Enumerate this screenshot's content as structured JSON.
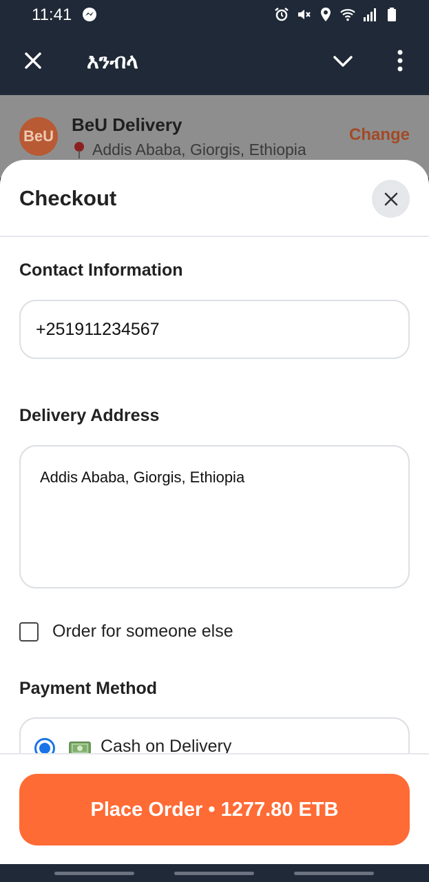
{
  "status_bar": {
    "time": "11:41",
    "icons": [
      "messenger-icon",
      "alarm-icon",
      "mute-icon",
      "location-icon",
      "wifi-icon",
      "signal-icon",
      "battery-icon"
    ]
  },
  "app_bar": {
    "title": "እንብላ",
    "icons": [
      "close-icon",
      "chevron-down-icon",
      "more-vertical-icon"
    ]
  },
  "shop": {
    "avatar_text": "BeU",
    "name": "BeU Delivery",
    "location": "Addis Ababa, Giorgis, Ethiopia",
    "change_label": "Change"
  },
  "checkout": {
    "title": "Checkout",
    "contact_label": "Contact Information",
    "phone_value": "+251911234567",
    "address_label": "Delivery Address",
    "address_value": "Addis Ababa, Giorgis, Ethiopia",
    "someone_else_label": "Order for someone else",
    "someone_else_checked": false,
    "payment_label": "Payment Method",
    "payment_option": "Cash on Delivery",
    "payment_selected": true,
    "place_order_label": "Place Order • 1277.80 ETB"
  },
  "colors": {
    "header_bg": "#1f2937",
    "accent": "#ff6b35",
    "radio": "#1a73e8"
  }
}
